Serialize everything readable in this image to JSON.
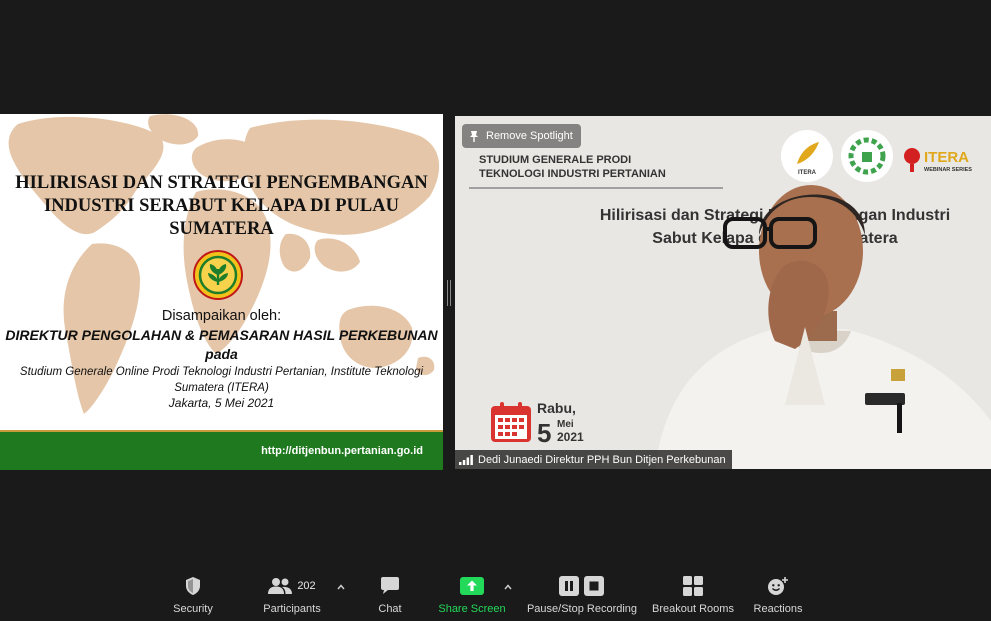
{
  "slide": {
    "title_line1": "HILIRISASI DAN STRATEGI PENGEMBANGAN",
    "title_line2": "INDUSTRI SERABUT KELAPA DI PULAU",
    "title_line3": "SUMATERA",
    "presented_by": "Disampaikan oleh:",
    "presenter": "DIREKTUR PENGOLAHAN & PEMASARAN HASIL PERKEBUNAN",
    "pada": "pada",
    "event_line1": "Studium Generale Online Prodi Teknologi Industri Pertanian, Institute Teknologi",
    "event_line2": "Sumatera (ITERA)",
    "date": "Jakarta, 5 Mei 2021",
    "url": "http://ditjenbun.pertanian.go.id",
    "colors": {
      "footer_green": "#1f7a1f",
      "map": "#e5c6a8",
      "gold_line": "#c99a3a"
    }
  },
  "video": {
    "spotlight_label": "Remove Spotlight",
    "banner_line1": "STUDIUM GENERALE PRODI",
    "banner_line2": "TEKNOLOGI INDUSTRI PERTANIAN",
    "title_line1": "Hilirisasi dan Strategi Pengembangan Industri",
    "title_line2": "Sabut Kelapa di Pulau Sumatera",
    "badge_text": "ITERA",
    "itera_logo": "ITERA",
    "itera_sub": "WEBINAR SERIES",
    "day_name": "Rabu,",
    "day_number": "5",
    "month": "Mei",
    "year": "2021",
    "participant_name": "Dedi Junaedi Direktur PPH Bun Ditjen Perkebunan",
    "signal_icon": "signal-bars-icon"
  },
  "toolbar": {
    "security": "Security",
    "participants": "Participants",
    "participant_count": "202",
    "chat": "Chat",
    "share_screen": "Share Screen",
    "record": "Pause/Stop Recording",
    "breakout": "Breakout Rooms",
    "reactions": "Reactions",
    "colors": {
      "share_green": "#23d959",
      "label": "#d8d8d8"
    }
  }
}
